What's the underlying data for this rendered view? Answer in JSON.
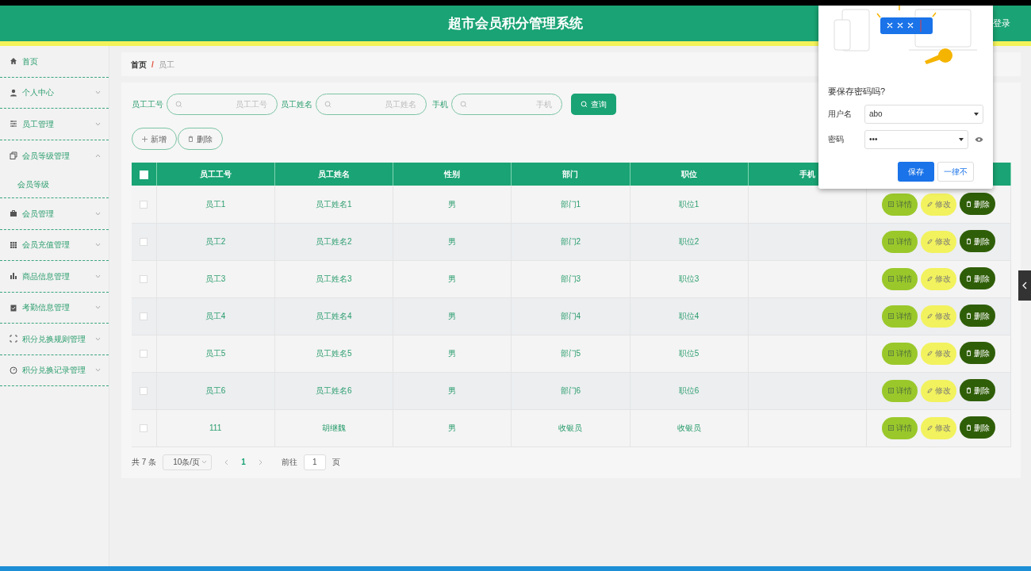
{
  "header": {
    "title": "超市会员积分管理系统",
    "logout": "登录"
  },
  "sidebar": {
    "items": [
      {
        "label": "首页",
        "kind": "link"
      },
      {
        "label": "个人中心",
        "kind": "menu",
        "expanded": false
      },
      {
        "label": "员工管理",
        "kind": "menu",
        "expanded": false
      },
      {
        "label": "会员等级管理",
        "kind": "menu",
        "expanded": true,
        "children": [
          {
            "label": "会员等级"
          }
        ]
      },
      {
        "label": "会员管理",
        "kind": "menu",
        "expanded": false
      },
      {
        "label": "会员充值管理",
        "kind": "menu",
        "expanded": false
      },
      {
        "label": "商品信息管理",
        "kind": "menu",
        "expanded": false
      },
      {
        "label": "考勤信息管理",
        "kind": "menu",
        "expanded": false
      },
      {
        "label": "积分兑换规则管理",
        "kind": "menu",
        "expanded": false
      },
      {
        "label": "积分兑换记录管理",
        "kind": "menu",
        "expanded": false
      }
    ]
  },
  "breadcrumb": {
    "items": [
      "首页",
      "员工"
    ],
    "separator": "/"
  },
  "search": {
    "fields": [
      {
        "label": "员工工号",
        "placeholder": "员工工号"
      },
      {
        "label": "员工姓名",
        "placeholder": "员工姓名"
      },
      {
        "label": "手机",
        "placeholder": "手机"
      }
    ],
    "button": "查询"
  },
  "actions": [
    "新增",
    "删除"
  ],
  "table": {
    "select_all": false,
    "columns": [
      "员工工号",
      "员工姓名",
      "性别",
      "部门",
      "职位",
      "手机"
    ],
    "rows": [
      {
        "checked": false,
        "cells": [
          "员工1",
          "员工姓名1",
          "男",
          "部门1",
          "职位1"
        ],
        "actions": [
          "详情",
          "修改",
          "删除"
        ]
      },
      {
        "checked": false,
        "cells": [
          "员工2",
          "员工姓名2",
          "男",
          "部门2",
          "职位2"
        ],
        "actions": [
          "详情",
          "修改",
          "删除"
        ]
      },
      {
        "checked": false,
        "cells": [
          "员工3",
          "员工姓名3",
          "男",
          "部门3",
          "职位3"
        ],
        "actions": [
          "详情",
          "修改",
          "删除"
        ]
      },
      {
        "checked": false,
        "cells": [
          "员工4",
          "员工姓名4",
          "男",
          "部门4",
          "职位4"
        ],
        "actions": [
          "详情",
          "修改",
          "删除"
        ]
      },
      {
        "checked": false,
        "cells": [
          "员工5",
          "员工姓名5",
          "男",
          "部门5",
          "职位5"
        ],
        "actions": [
          "详情",
          "修改",
          "删除"
        ]
      },
      {
        "checked": false,
        "cells": [
          "员工6",
          "员工姓名6",
          "男",
          "部门6",
          "职位6"
        ],
        "actions": [
          "详情",
          "修改",
          "删除"
        ]
      },
      {
        "checked": false,
        "cells": [
          "111",
          "胡继魏",
          "男",
          "收银员",
          "收银员"
        ],
        "actions": [
          "详情",
          "修改",
          "删除"
        ]
      }
    ]
  },
  "pagination": {
    "total": "共 7 条",
    "page_size": "10条/页",
    "pages": [
      {
        "label": "1",
        "selected": true
      }
    ],
    "goto_label": "前往",
    "goto_value": "1",
    "page_unit": "页"
  },
  "password_popup": {
    "title": "要保存密码吗?",
    "username_label": "用户名",
    "username": "abo",
    "password_label": "密码",
    "password": "•••",
    "save": "保存",
    "never": "一律不"
  }
}
